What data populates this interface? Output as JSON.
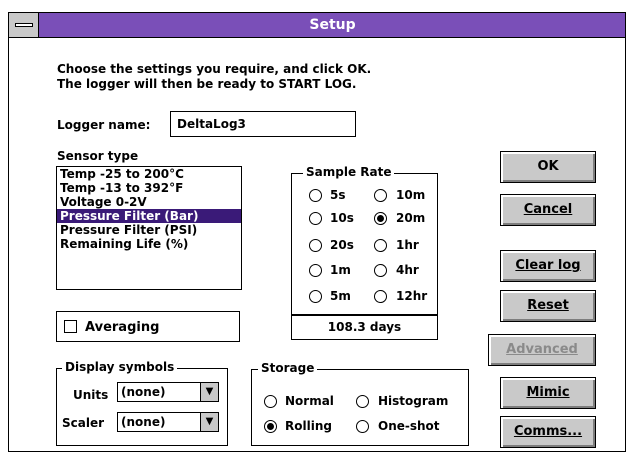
{
  "window": {
    "title": "Setup"
  },
  "instructions": {
    "line1": "Choose the settings you require, and click OK.",
    "line2": "The logger will then be ready to START LOG."
  },
  "logger_name": {
    "label": "Logger name:",
    "value": "DeltaLog3"
  },
  "sensor_type": {
    "label": "Sensor type",
    "items": [
      "Temp  -25 to 200°C",
      "Temp  -13 to 392°F",
      "Voltage 0-2V",
      "Pressure Filter (Bar)",
      "Pressure Filter (PSI)",
      "Remaining Life (%)"
    ],
    "selected": "Pressure Filter (Bar)"
  },
  "averaging": {
    "label": "Averaging",
    "checked": false
  },
  "sample_rate": {
    "label": "Sample Rate",
    "options_left": [
      "5s",
      "10s",
      "20s",
      "1m",
      "5m"
    ],
    "options_right": [
      "10m",
      "20m",
      "1hr",
      "4hr",
      "12hr"
    ],
    "selected": "20m",
    "duration": "108.3 days"
  },
  "display_symbols": {
    "label": "Display symbols",
    "units_label": "Units",
    "units_value": "(none)",
    "scaler_label": "Scaler",
    "scaler_value": "(none)"
  },
  "storage": {
    "label": "Storage",
    "options": [
      "Normal",
      "Histogram",
      "Rolling",
      "One-shot"
    ],
    "selected": "Rolling"
  },
  "buttons": {
    "ok": "OK",
    "cancel": "Cancel",
    "clear_log": "Clear log",
    "reset": "Reset",
    "advanced": "Advanced",
    "mimic": "Mimic",
    "comms": "Comms..."
  },
  "colors": {
    "title_bar": "#7a4fb8",
    "selection": "#3a1a78",
    "button_face": "#c9c9c9"
  }
}
